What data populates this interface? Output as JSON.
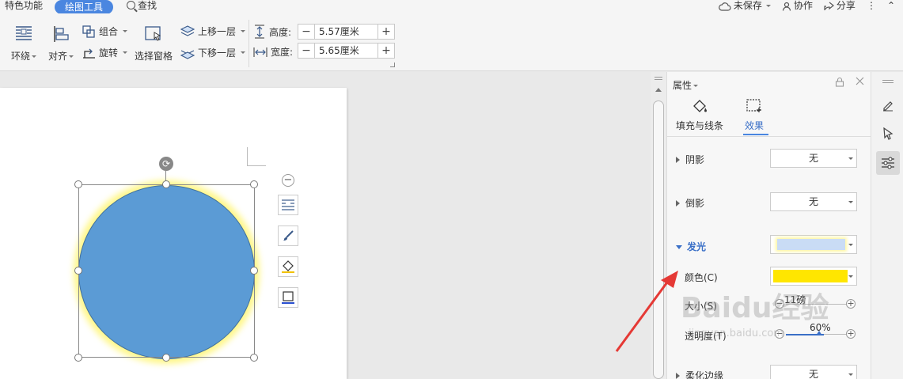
{
  "tabs": {
    "featured": "特色功能",
    "drawing_tools": "绘图工具",
    "search": "查找"
  },
  "top_right": {
    "unsaved": "未保存",
    "collaborate": "协作",
    "share": "分享",
    "more": "⋮",
    "collapse": "⌃"
  },
  "ribbon": {
    "wrap": "环绕",
    "align": "对齐",
    "group": "组合",
    "rotate": "旋转",
    "select_pane": "选择窗格",
    "bring_forward": "上移一层",
    "send_backward": "下移一层",
    "height_label": "高度:",
    "height_value": "5.57厘米",
    "width_label": "宽度:",
    "width_value": "5.65厘米",
    "minus": "−",
    "plus": "+"
  },
  "panel": {
    "title": "属性",
    "tab_fill": "填充与线条",
    "tab_effect": "效果",
    "shadow_label": "阴影",
    "shadow_value": "无",
    "reflection_label": "倒影",
    "reflection_value": "无",
    "glow_label": "发光",
    "color_label": "颜色(C)",
    "size_label": "大小(S)",
    "size_value": "11磅",
    "transparency_label": "透明度(T)",
    "transparency_value": "60%",
    "soft_edge_label": "柔化边缘",
    "soft_edge_value": "无",
    "glow_color": "#ffe600",
    "glow_preview_color": "#c9dcf5"
  },
  "watermark": {
    "brand": "Baidu经验",
    "url": "jingyan.baidu.com"
  }
}
